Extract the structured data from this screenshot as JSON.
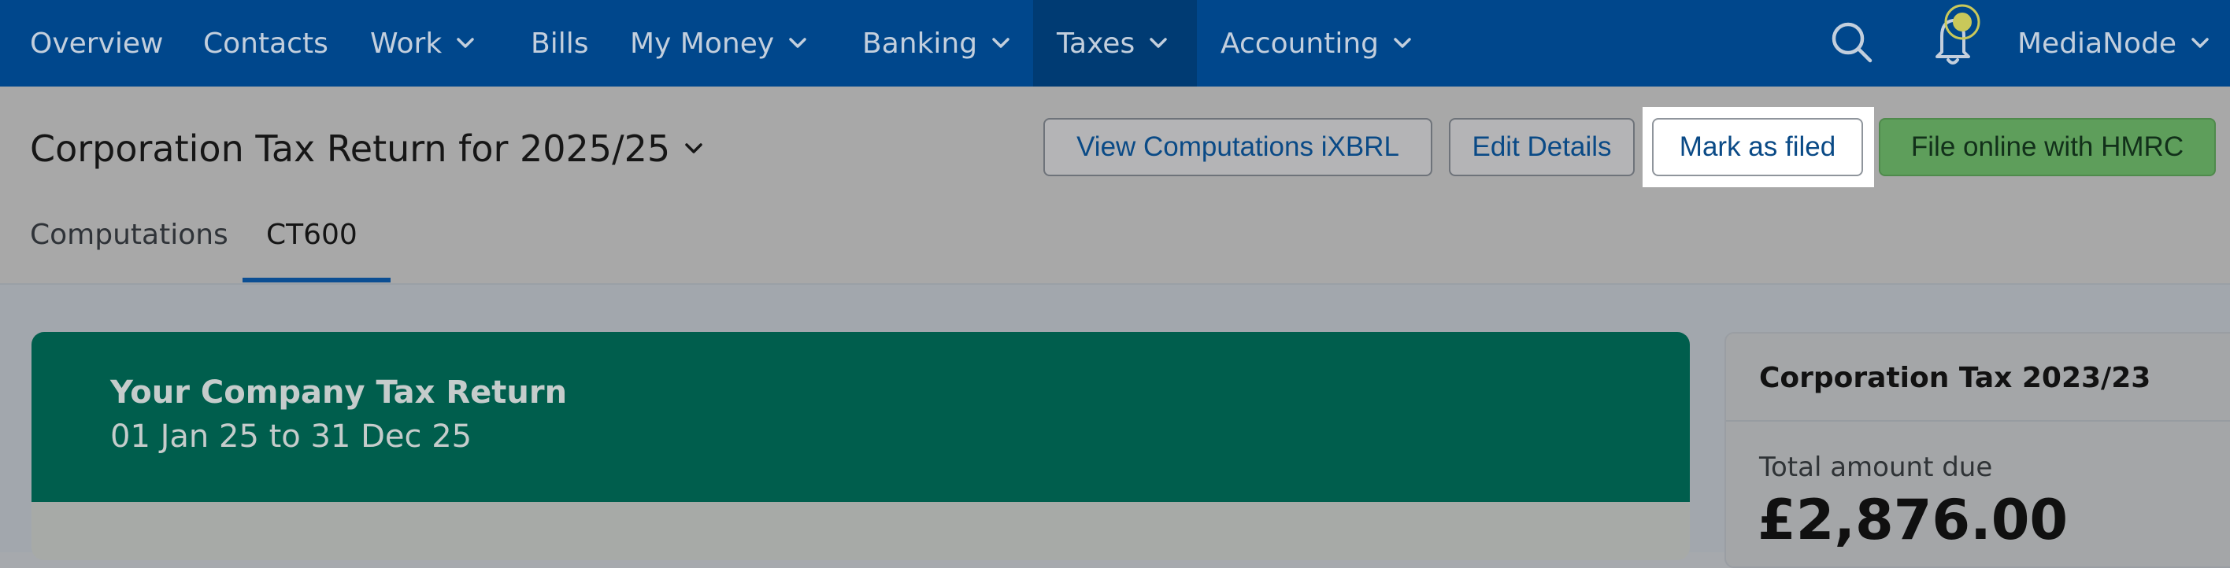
{
  "nav": {
    "overview": "Overview",
    "contacts": "Contacts",
    "work": "Work",
    "bills": "Bills",
    "my_money": "My Money",
    "banking": "Banking",
    "taxes": "Taxes",
    "accounting": "Accounting",
    "company": "MediaNode"
  },
  "header": {
    "title": "Corporation Tax Return for 2025/25",
    "buttons": {
      "view_computations": "View Computations iXBRL",
      "edit_details": "Edit Details",
      "mark_as_filed": "Mark as filed",
      "file_online": "File online with HMRC"
    }
  },
  "tabs": {
    "computations": "Computations",
    "ct600": "CT600"
  },
  "main_card": {
    "title": "Your Company Tax Return",
    "period": "01 Jan 25 to 31 Dec 25"
  },
  "side_card": {
    "title": "Corporation Tax 2023/23",
    "label": "Total amount due",
    "amount": "£2,876.00"
  },
  "colors": {
    "nav_bg": "#00478c",
    "card_header": "#005e4d",
    "primary_button": "#5e9e5b"
  },
  "icons": [
    "chevron-down-icon",
    "search-icon",
    "bell-icon",
    "notification-dot-icon"
  ]
}
